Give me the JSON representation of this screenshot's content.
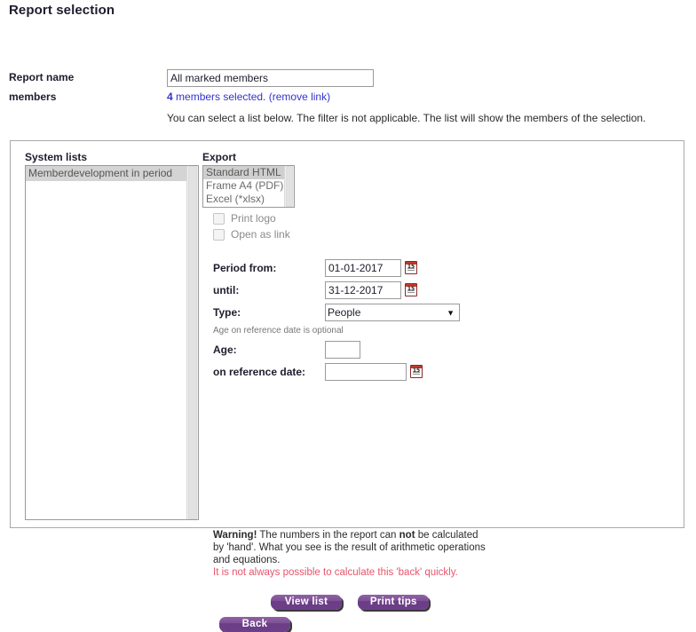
{
  "page": {
    "title": "Report selection"
  },
  "top_form": {
    "report_name_label": "Report name",
    "report_name_value": "All marked members",
    "members_label": "members",
    "members_count": "4",
    "members_selected_text": " members selected. ",
    "remove_link_text": "(remove link)",
    "hint": "You can select a list below. The filter is not applicable. The list will show the members of the selection."
  },
  "panel": {
    "system_lists": {
      "heading": "System lists",
      "items": [
        {
          "label": "Memberdevelopment in period",
          "selected": true
        }
      ]
    },
    "export": {
      "heading": "Export",
      "options": [
        {
          "label": "Standard HTML",
          "selected": true
        },
        {
          "label": "Frame A4 (PDF)",
          "selected": false
        },
        {
          "label": "Excel (*xlsx)",
          "selected": false
        }
      ],
      "checkboxes": [
        {
          "label": "Print logo",
          "checked": false
        },
        {
          "label": "Open as link",
          "checked": false
        }
      ]
    },
    "fields": {
      "period_from_label": "Period from:",
      "period_from_value": "01-01-2017",
      "until_label": "until:",
      "until_value": "31-12-2017",
      "type_label": "Type:",
      "type_value": "People",
      "type_options": [
        "People"
      ],
      "age_note": "Age on reference date is optional",
      "age_label": "Age:",
      "age_value": "",
      "reference_date_label": "on reference date:",
      "reference_date_value": "",
      "calendar_icon_text": "15"
    },
    "warning": {
      "title": "Warning!",
      "line1_a": "  The numbers in the report can ",
      "line1_bold": "not",
      "line1_b": " be calculated",
      "line2": "by 'hand'. What you see is the result of arithmetic operations",
      "line3": "and equations.",
      "red_line": "It is not always possible to calculate this 'back' quickly."
    },
    "buttons": {
      "view_list": "View list",
      "print_tips": "Print tips",
      "back": "Back"
    }
  },
  "colors": {
    "accent_purple": "#7d4f96",
    "link_blue": "#3333cc",
    "warning_red": "#e8556b",
    "panel_border": "#a9a9a9"
  }
}
